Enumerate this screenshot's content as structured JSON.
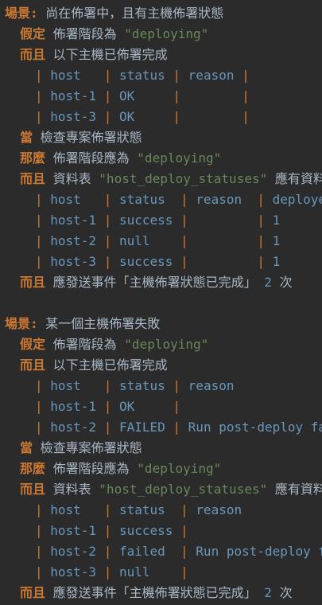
{
  "lines": [
    {
      "indent": 0,
      "keyword": "場景:",
      "text": " 尚在佈署中，且有主機佈署狀態"
    },
    {
      "indent": 2,
      "keyword": "假定",
      "text": " 佈署階段為 ",
      "string": "\"deploying\""
    },
    {
      "indent": 2,
      "keyword": "而且",
      "text": " 以下主機已佈署完成"
    },
    {
      "indent": 4,
      "table": [
        "host  ",
        "status",
        "reason",
        ""
      ]
    },
    {
      "indent": 4,
      "table": [
        "host-1",
        "OK    ",
        "      ",
        ""
      ]
    },
    {
      "indent": 4,
      "table": [
        "host-3",
        "OK    ",
        "      ",
        ""
      ]
    },
    {
      "indent": 2,
      "keyword": "當",
      "text": " 檢查專案佈署狀態"
    },
    {
      "indent": 2,
      "keyword": "那麼",
      "text": " 佈署階段應為 ",
      "string": "\"deploying\""
    },
    {
      "indent": 2,
      "keyword": "而且",
      "text": " 資料表 ",
      "string": "\"host_deploy_statuses\"",
      "tail": " 應有資料"
    },
    {
      "indent": 4,
      "table": [
        "host  ",
        "status ",
        "reason ",
        "deployed"
      ]
    },
    {
      "indent": 4,
      "table": [
        "host-1",
        "success",
        "       ",
        "1"
      ]
    },
    {
      "indent": 4,
      "table": [
        "host-2",
        "null   ",
        "       ",
        "1"
      ]
    },
    {
      "indent": 4,
      "table": [
        "host-3",
        "success",
        "       ",
        "1"
      ]
    },
    {
      "indent": 2,
      "keyword": "而且",
      "text": " 應發送事件「主機佈署狀態已完成」 ",
      "number": "2",
      "tail": " 次"
    },
    {
      "blank": true
    },
    {
      "indent": 0,
      "keyword": "場景:",
      "text": " 某一個主機佈署失敗"
    },
    {
      "indent": 2,
      "keyword": "假定",
      "text": " 佈署階段為 ",
      "string": "\"deploying\""
    },
    {
      "indent": 2,
      "keyword": "而且",
      "text": " 以下主機已佈署完成"
    },
    {
      "indent": 4,
      "table": [
        "host  ",
        "status",
        "reason"
      ]
    },
    {
      "indent": 4,
      "table": [
        "host-1",
        "OK    ",
        ""
      ]
    },
    {
      "indent": 4,
      "table": [
        "host-2",
        "FAILED",
        "Run post-deploy failed"
      ]
    },
    {
      "indent": 2,
      "keyword": "當",
      "text": " 檢查專案佈署狀態"
    },
    {
      "indent": 2,
      "keyword": "那麼",
      "text": " 佈署階段應為 ",
      "string": "\"deploying\""
    },
    {
      "indent": 2,
      "keyword": "而且",
      "text": " 資料表 ",
      "string": "\"host_deploy_statuses\"",
      "tail": " 應有資料"
    },
    {
      "indent": 4,
      "table": [
        "host  ",
        "status ",
        "reason"
      ]
    },
    {
      "indent": 4,
      "table": [
        "host-1",
        "success",
        ""
      ]
    },
    {
      "indent": 4,
      "table": [
        "host-2",
        "failed ",
        "Run post-deploy failed"
      ]
    },
    {
      "indent": 4,
      "table": [
        "host-3",
        "null   ",
        ""
      ]
    },
    {
      "indent": 2,
      "keyword": "而且",
      "text": " 應發送事件「主機佈署狀態已完成」 ",
      "number": "2",
      "tail": " 次"
    }
  ],
  "colors": {
    "background": "#2b2b2b",
    "keyword": "#cc7832",
    "text": "#a9b7c6",
    "string": "#6a8759",
    "number": "#6897bb"
  }
}
